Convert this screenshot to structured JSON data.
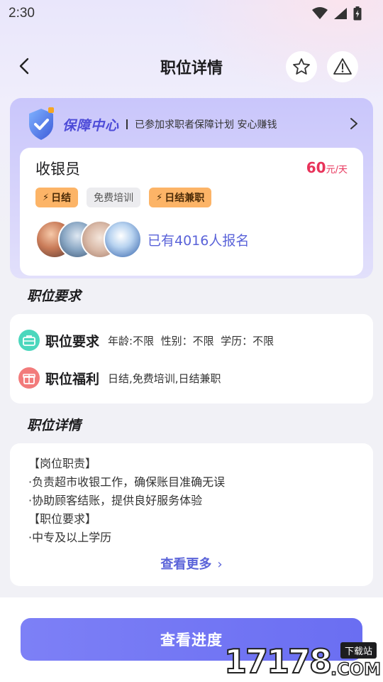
{
  "status": {
    "time": "2:30"
  },
  "nav": {
    "title": "职位详情"
  },
  "guarantee": {
    "title": "保障中心",
    "text": "已参加求职者保障计划 安心赚钱"
  },
  "job": {
    "name": "收银员",
    "salary_amount": "60",
    "salary_unit": "元/天",
    "tags": [
      "日结",
      "免费培训",
      "日结兼职"
    ],
    "signup_text": "已有4016人报名"
  },
  "requirements_section": {
    "title": "职位要求",
    "rows": [
      {
        "label": "职位要求",
        "value": "年龄:不限  性别：不限  学历：不限"
      },
      {
        "label": "职位福利",
        "value": "日结,免费培训,日结兼职"
      }
    ]
  },
  "details_section": {
    "title": "职位详情",
    "lines": [
      "【岗位职责】",
      "·负责超市收银工作，确保账目准确无误",
      "·协助顾客结账，提供良好服务体验",
      "【职位要求】",
      "·中专及以上学历"
    ],
    "more_label": "查看更多"
  },
  "bottom": {
    "button_label": "查看进度"
  },
  "watermark": {
    "number": "17178",
    "domain": ".COM",
    "badge": "下载站"
  },
  "colors": {
    "accent": "#6a6ef2",
    "salary": "#e8335a",
    "tag_orange": "#fcb467",
    "link": "#5a63d9"
  }
}
